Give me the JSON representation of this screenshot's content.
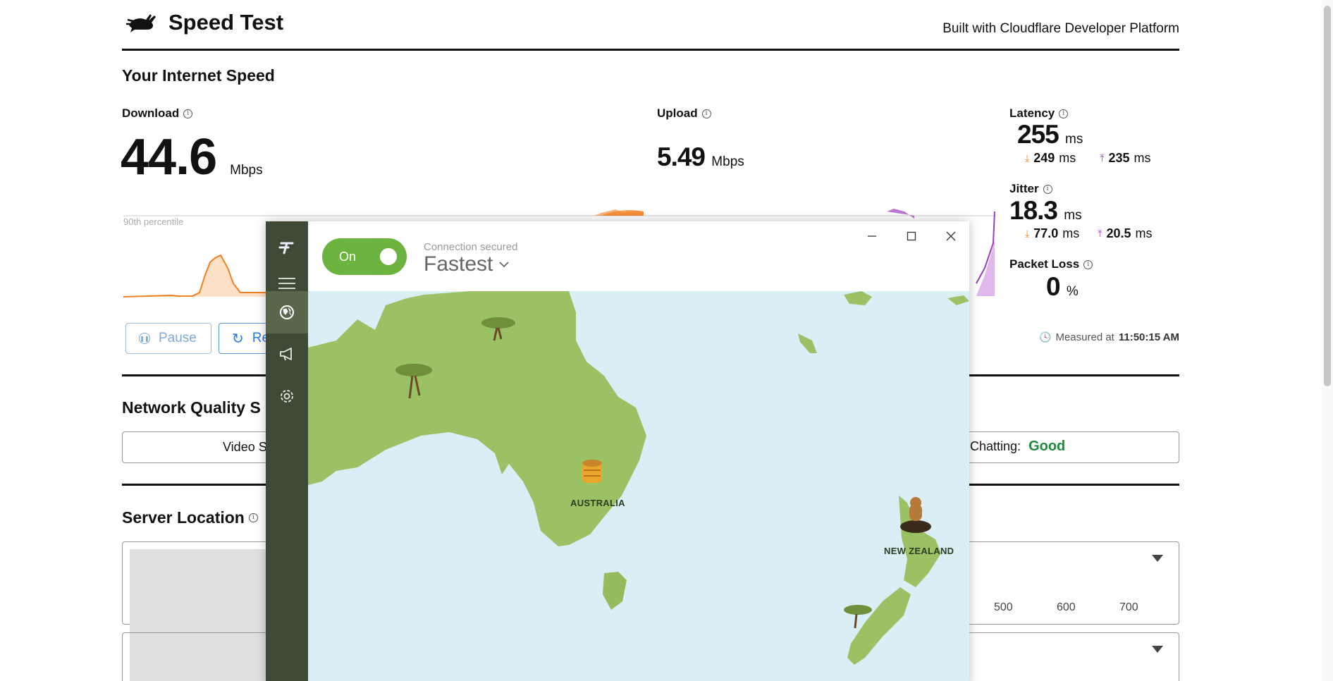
{
  "header": {
    "title": "Speed Test",
    "built_with": "Built with Cloudflare Developer Platform"
  },
  "speed": {
    "heading": "Your Internet Speed",
    "download": {
      "label": "Download",
      "value": "44.6",
      "unit": "Mbps"
    },
    "upload": {
      "label": "Upload",
      "value": "5.49",
      "unit": "Mbps"
    },
    "latency": {
      "label": "Latency",
      "value": "255",
      "unit": "ms",
      "down": "249",
      "up": "235",
      "sub_unit": "ms"
    },
    "jitter": {
      "label": "Jitter",
      "value": "18.3",
      "unit": "ms",
      "down": "77.0",
      "up": "20.5",
      "sub_unit": "ms"
    },
    "packet_loss": {
      "label": "Packet Loss",
      "value": "0",
      "unit": "%"
    },
    "percentile_label": "90th percentile",
    "pause_label": "Pause",
    "retest_label": "Re",
    "measured_prefix": "Measured at",
    "measured_time": "11:50:15 AM"
  },
  "quality": {
    "heading": "Network Quality S",
    "item_video": "Video S",
    "item_chat_label": "Chatting:",
    "item_chat_value": "Good"
  },
  "location": {
    "heading": "Server Location",
    "ticks": [
      "500",
      "600",
      "700"
    ]
  },
  "vpn": {
    "toggle_label": "On",
    "status": "Connection secured",
    "server": "Fastest",
    "places": [
      "AUSTRALIA",
      "NEW ZEALAND"
    ]
  },
  "colors": {
    "download": "#f38020",
    "upload": "#9b3fbf",
    "good": "#1e8a3c",
    "vpn_sidebar": "#3e4a35",
    "vpn_toggle": "#6db33f",
    "ocean": "#d9eef5",
    "land": "#9ac264"
  }
}
